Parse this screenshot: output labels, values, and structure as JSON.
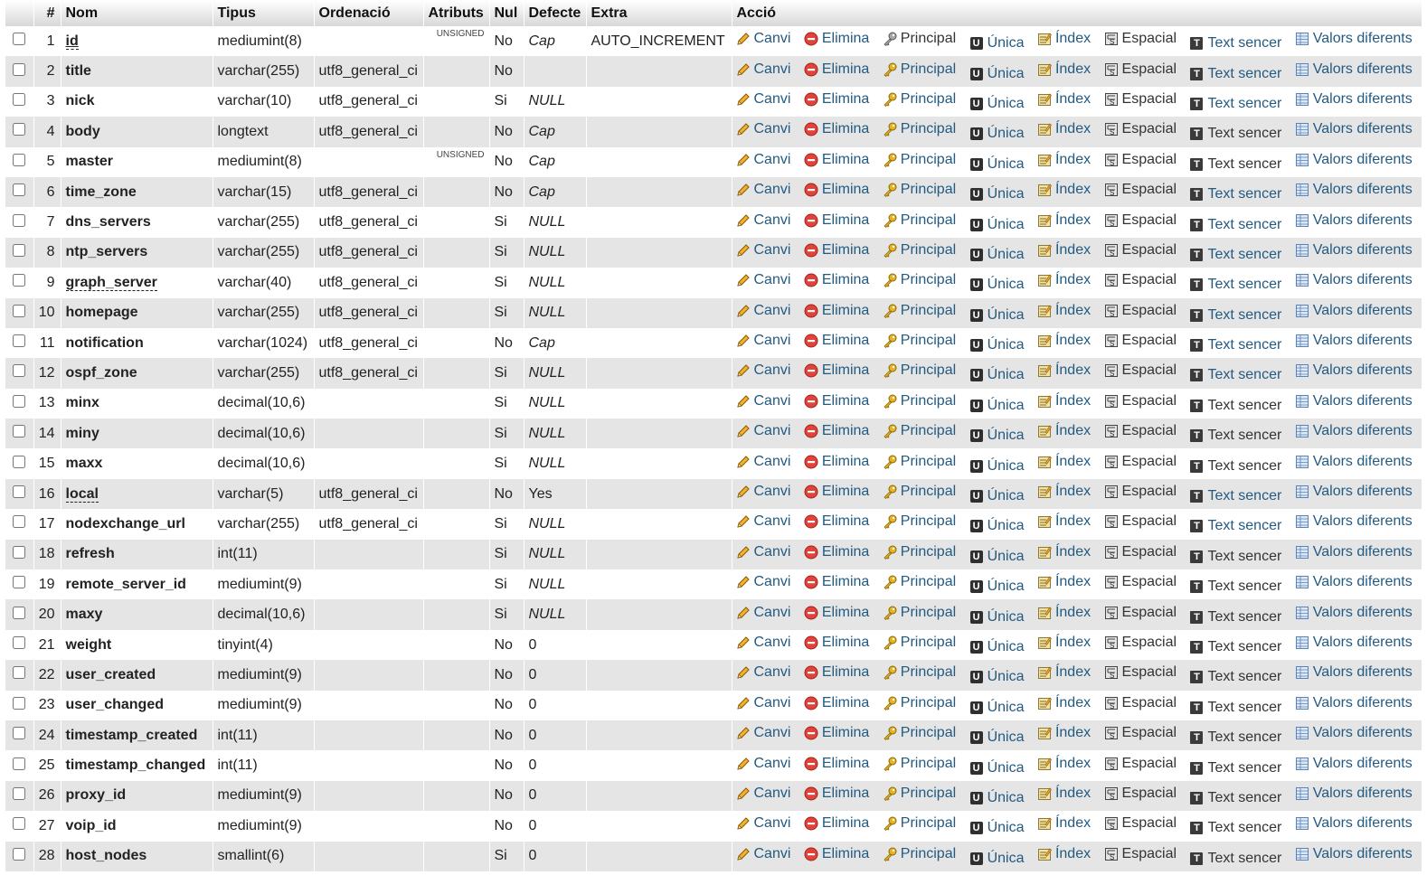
{
  "headers": {
    "num": "#",
    "name": "Nom",
    "type": "Tipus",
    "collation": "Ordenació",
    "attributes": "Atributs",
    "null": "Nul",
    "default": "Defecte",
    "extra": "Extra",
    "action": "Acció"
  },
  "actions": {
    "change": "Canvi",
    "drop": "Elimina",
    "primary": "Principal",
    "unique": "Única",
    "index": "Índex",
    "spatial": "Espacial",
    "fulltext": "Text sencer",
    "distinct": "Valors diferents"
  },
  "rows": [
    {
      "num": "1",
      "name": "id",
      "type": "mediumint(8)",
      "collation": "",
      "attributes": "UNSIGNED",
      "null": "No",
      "default": "Cap",
      "extra": "AUTO_INCREMENT"
    },
    {
      "num": "2",
      "name": "title",
      "type": "varchar(255)",
      "collation": "utf8_general_ci",
      "attributes": "",
      "null": "No",
      "default": "",
      "extra": ""
    },
    {
      "num": "3",
      "name": "nick",
      "type": "varchar(10)",
      "collation": "utf8_general_ci",
      "attributes": "",
      "null": "Si",
      "default": "NULL",
      "extra": ""
    },
    {
      "num": "4",
      "name": "body",
      "type": "longtext",
      "collation": "utf8_general_ci",
      "attributes": "",
      "null": "No",
      "default": "Cap",
      "extra": ""
    },
    {
      "num": "5",
      "name": "master",
      "type": "mediumint(8)",
      "collation": "",
      "attributes": "UNSIGNED",
      "null": "No",
      "default": "Cap",
      "extra": ""
    },
    {
      "num": "6",
      "name": "time_zone",
      "type": "varchar(15)",
      "collation": "utf8_general_ci",
      "attributes": "",
      "null": "No",
      "default": "Cap",
      "extra": ""
    },
    {
      "num": "7",
      "name": "dns_servers",
      "type": "varchar(255)",
      "collation": "utf8_general_ci",
      "attributes": "",
      "null": "Si",
      "default": "NULL",
      "extra": ""
    },
    {
      "num": "8",
      "name": "ntp_servers",
      "type": "varchar(255)",
      "collation": "utf8_general_ci",
      "attributes": "",
      "null": "Si",
      "default": "NULL",
      "extra": ""
    },
    {
      "num": "9",
      "name": "graph_server",
      "type": "varchar(40)",
      "collation": "utf8_general_ci",
      "attributes": "",
      "null": "Si",
      "default": "NULL",
      "extra": ""
    },
    {
      "num": "10",
      "name": "homepage",
      "type": "varchar(255)",
      "collation": "utf8_general_ci",
      "attributes": "",
      "null": "Si",
      "default": "NULL",
      "extra": ""
    },
    {
      "num": "11",
      "name": "notification",
      "type": "varchar(1024)",
      "collation": "utf8_general_ci",
      "attributes": "",
      "null": "No",
      "default": "Cap",
      "extra": ""
    },
    {
      "num": "12",
      "name": "ospf_zone",
      "type": "varchar(255)",
      "collation": "utf8_general_ci",
      "attributes": "",
      "null": "Si",
      "default": "NULL",
      "extra": ""
    },
    {
      "num": "13",
      "name": "minx",
      "type": "decimal(10,6)",
      "collation": "",
      "attributes": "",
      "null": "Si",
      "default": "NULL",
      "extra": ""
    },
    {
      "num": "14",
      "name": "miny",
      "type": "decimal(10,6)",
      "collation": "",
      "attributes": "",
      "null": "Si",
      "default": "NULL",
      "extra": ""
    },
    {
      "num": "15",
      "name": "maxx",
      "type": "decimal(10,6)",
      "collation": "",
      "attributes": "",
      "null": "Si",
      "default": "NULL",
      "extra": ""
    },
    {
      "num": "16",
      "name": "local",
      "type": "varchar(5)",
      "collation": "utf8_general_ci",
      "attributes": "",
      "null": "No",
      "default": "Yes",
      "extra": ""
    },
    {
      "num": "17",
      "name": "nodexchange_url",
      "type": "varchar(255)",
      "collation": "utf8_general_ci",
      "attributes": "",
      "null": "Si",
      "default": "NULL",
      "extra": ""
    },
    {
      "num": "18",
      "name": "refresh",
      "type": "int(11)",
      "collation": "",
      "attributes": "",
      "null": "Si",
      "default": "NULL",
      "extra": ""
    },
    {
      "num": "19",
      "name": "remote_server_id",
      "type": "mediumint(9)",
      "collation": "",
      "attributes": "",
      "null": "Si",
      "default": "NULL",
      "extra": ""
    },
    {
      "num": "20",
      "name": "maxy",
      "type": "decimal(10,6)",
      "collation": "",
      "attributes": "",
      "null": "Si",
      "default": "NULL",
      "extra": ""
    },
    {
      "num": "21",
      "name": "weight",
      "type": "tinyint(4)",
      "collation": "",
      "attributes": "",
      "null": "No",
      "default": "0",
      "extra": ""
    },
    {
      "num": "22",
      "name": "user_created",
      "type": "mediumint(9)",
      "collation": "",
      "attributes": "",
      "null": "No",
      "default": "0",
      "extra": ""
    },
    {
      "num": "23",
      "name": "user_changed",
      "type": "mediumint(9)",
      "collation": "",
      "attributes": "",
      "null": "No",
      "default": "0",
      "extra": ""
    },
    {
      "num": "24",
      "name": "timestamp_created",
      "type": "int(11)",
      "collation": "",
      "attributes": "",
      "null": "No",
      "default": "0",
      "extra": ""
    },
    {
      "num": "25",
      "name": "timestamp_changed",
      "type": "int(11)",
      "collation": "",
      "attributes": "",
      "null": "No",
      "default": "0",
      "extra": ""
    },
    {
      "num": "26",
      "name": "proxy_id",
      "type": "mediumint(9)",
      "collation": "",
      "attributes": "",
      "null": "No",
      "default": "0",
      "extra": ""
    },
    {
      "num": "27",
      "name": "voip_id",
      "type": "mediumint(9)",
      "collation": "",
      "attributes": "",
      "null": "No",
      "default": "0",
      "extra": ""
    },
    {
      "num": "28",
      "name": "host_nodes",
      "type": "smallint(6)",
      "collation": "",
      "attributes": "",
      "null": "Si",
      "default": "0",
      "extra": ""
    }
  ]
}
